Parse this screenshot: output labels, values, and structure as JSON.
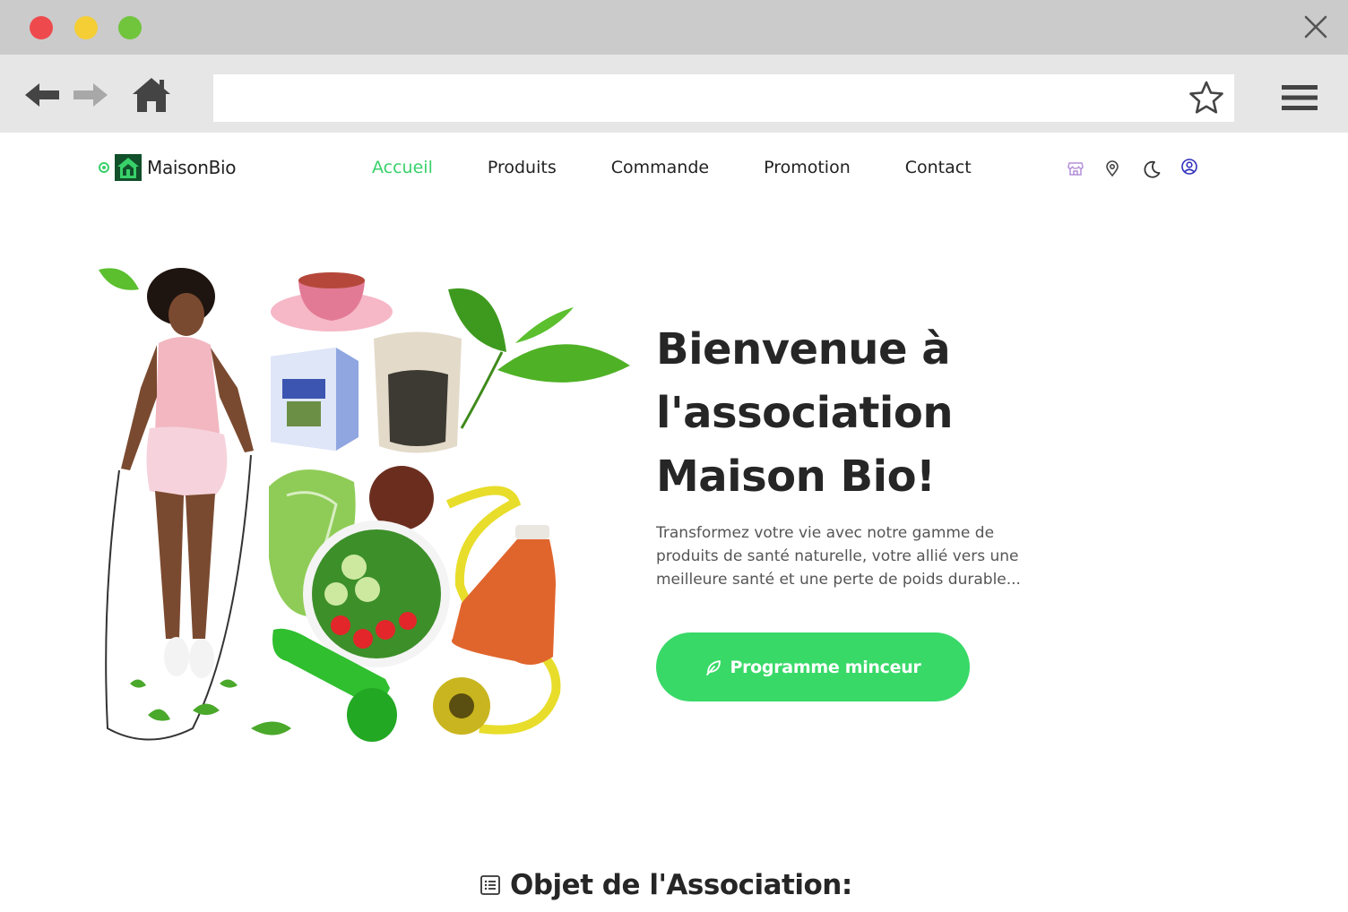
{
  "browser": {
    "url": "",
    "colors": {
      "close_red": "#ee4a4d",
      "minimize_yellow": "#f4ce34",
      "maximize_green": "#70c53c"
    }
  },
  "header": {
    "brand": "MaisonBio",
    "nav": [
      {
        "label": "Accueil",
        "active": true
      },
      {
        "label": "Produits",
        "active": false
      },
      {
        "label": "Commande",
        "active": false
      },
      {
        "label": "Promotion",
        "active": false
      },
      {
        "label": "Contact",
        "active": false
      }
    ],
    "icons": [
      "store-icon",
      "location-icon",
      "dark-mode-icon",
      "user-account-icon"
    ]
  },
  "hero": {
    "title": "Bienvenue à l'association Maison Bio!",
    "description": "Transformez votre vie avec notre gamme de produits de santé naturelle, votre allié vers une meilleure santé et une perte de poids durable...",
    "cta_label": "Programme minceur",
    "accent": "#39d968"
  },
  "section": {
    "title": "Objet de l'Association:"
  }
}
